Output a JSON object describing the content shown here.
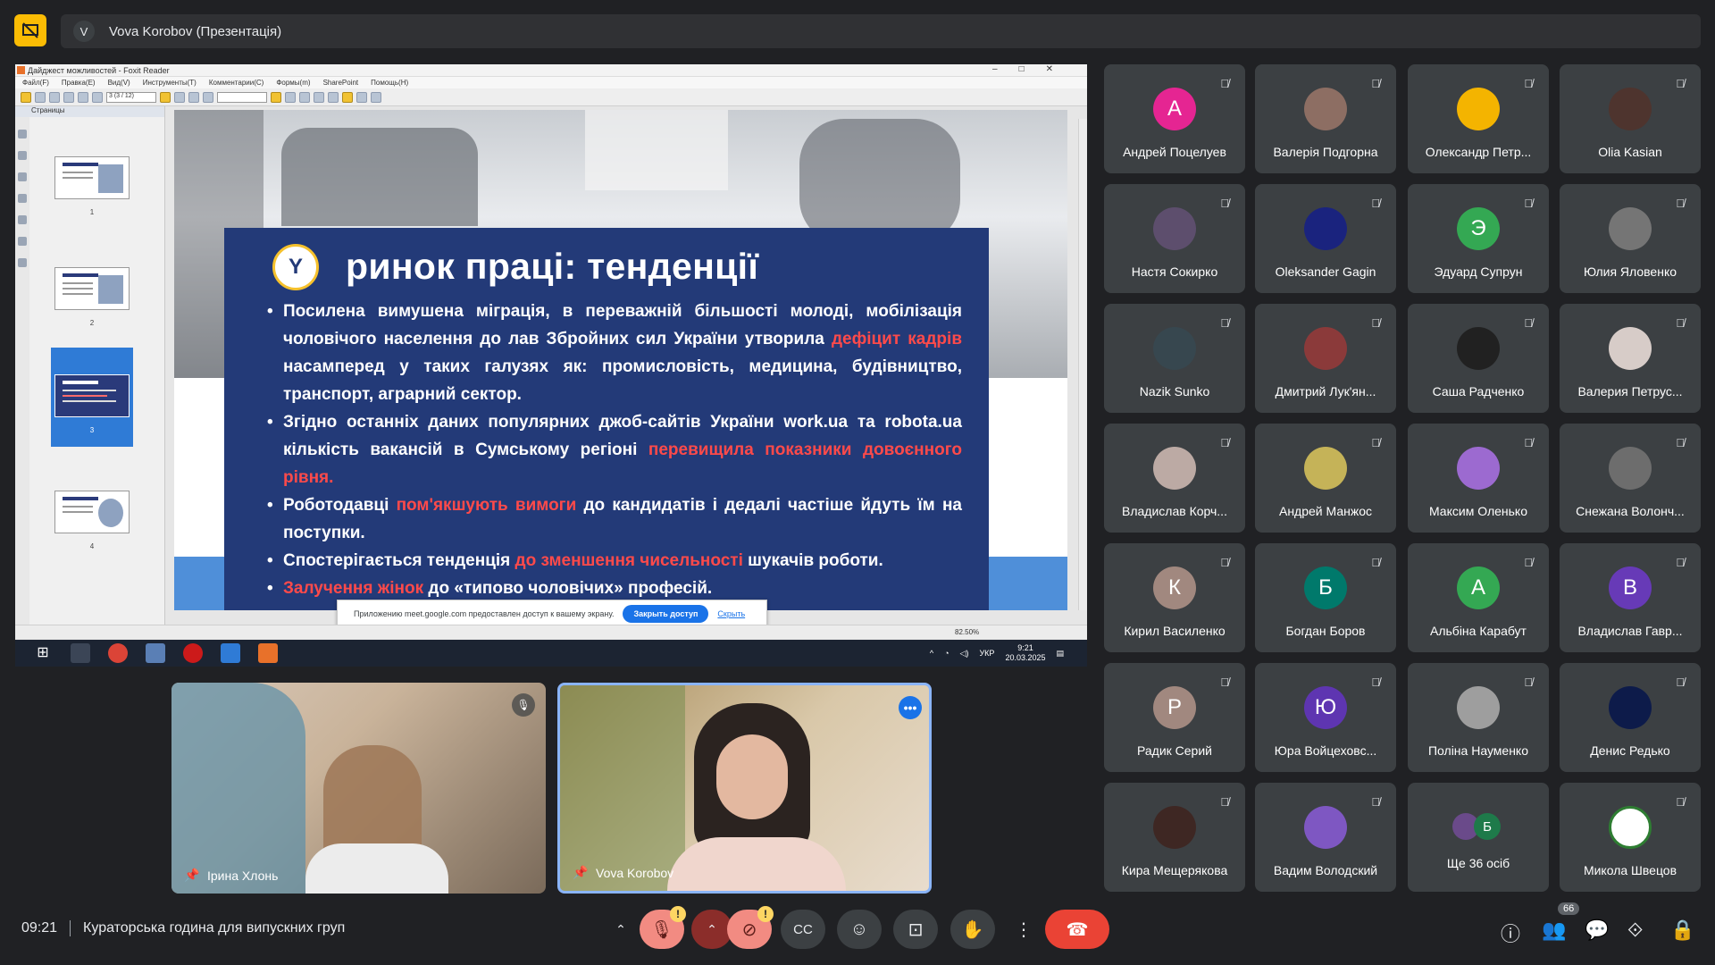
{
  "top": {
    "presenter_initial": "V",
    "presenter_label": "Vova Korobov (Презентація)"
  },
  "foxit": {
    "window_title": "Дайджест можливостей - Foxit Reader",
    "menu": [
      "Файл(F)",
      "Правка(E)",
      "Вид(V)",
      "Инструменты(T)",
      "Комментарии(C)",
      "Формы(m)",
      "SharePoint",
      "Помощь(H)"
    ],
    "page_field": "3 (3 / 12)",
    "sidebar_title": "Страницы",
    "thumbnails": [
      "1",
      "2",
      "3",
      "4"
    ],
    "zoom": "82.50%"
  },
  "slide": {
    "emblem_icon": "employment-service-emblem",
    "title": "ринок праці: тенденції",
    "b1_a": "Посилена вимушена міграція, в переважній більшості молоді, мобілізація чоловічого населення до лав Збройних сил України утворила ",
    "b1_red": "дефіцит кадрів",
    "b1_b": " насамперед у таких галузях як: промисловість, медицина, будівництво, транспорт, аграрний сектор.",
    "b2_a": "Згідно останніх даних популярних джоб-сайтів України work.ua та robota.ua кількість вакансій в Сумському регіоні ",
    "b2_red": "перевищила показники довоєнного рівня.",
    "b3_a": " Роботодавці ",
    "b3_red": "пом'якшують вимоги",
    "b3_b": " до кандидатів і дедалі частіше йдуть їм на поступки.",
    "b4_a": "Спостерігається тенденція ",
    "b4_red": "до зменшення чисельності",
    "b4_b": " шукачів роботи.",
    "b5_red": "Залучення жінок",
    "b5_b": " до «типово чоловічих» професій."
  },
  "share_notice": {
    "text": "Приложению meet.google.com предоставлен доступ к вашему экрану.",
    "stop_label": "Закрыть доступ",
    "hide_label": "Скрыть"
  },
  "taskbar": {
    "lang": "УКР",
    "time": "9:21",
    "date": "20.03.2025"
  },
  "pinned": [
    {
      "name": "Ірина Хлонь"
    },
    {
      "name": "Vova Korobov"
    }
  ],
  "participants": [
    {
      "name": "Андрей Поцелуев",
      "initial": "А",
      "color": "#e52592"
    },
    {
      "name": "Валерія Подгорна",
      "initial": "",
      "color": "#8d6e63"
    },
    {
      "name": "Олександр Петр...",
      "initial": "",
      "color": "#f4b400"
    },
    {
      "name": "Olia Kasian",
      "initial": "",
      "color": "#4e342e"
    },
    {
      "name": "Настя Сокирко",
      "initial": "",
      "color": "#5d4e6d"
    },
    {
      "name": "Oleksander Gagin",
      "initial": "",
      "color": "#1a237e"
    },
    {
      "name": "Эдуард Супрун",
      "initial": "Э",
      "color": "#34a853"
    },
    {
      "name": "Юлия Яловенко",
      "initial": "",
      "color": "#757575"
    },
    {
      "name": "Nazik Sunko",
      "initial": "",
      "color": "#37474f"
    },
    {
      "name": "Дмитрий Лук'ян...",
      "initial": "",
      "color": "#8b3a3a"
    },
    {
      "name": "Саша Радченко",
      "initial": "",
      "color": "#212121"
    },
    {
      "name": "Валерия Петрус...",
      "initial": "",
      "color": "#d7ccc8"
    },
    {
      "name": "Владислав Корч...",
      "initial": "",
      "color": "#bcaaa4"
    },
    {
      "name": "Андрей Манжос",
      "initial": "",
      "color": "#c5b358"
    },
    {
      "name": "Максим Оленько",
      "initial": "",
      "color": "#9c6ad0"
    },
    {
      "name": "Снежана Волонч...",
      "initial": "",
      "color": "#6d6d6d"
    },
    {
      "name": "Кирил Василенко",
      "initial": "К",
      "color": "#a1887f"
    },
    {
      "name": "Богдан Боров",
      "initial": "Б",
      "color": "#00796b"
    },
    {
      "name": "Альбіна Карабут",
      "initial": "А",
      "color": "#34a853"
    },
    {
      "name": "Владислав Гавр...",
      "initial": "В",
      "color": "#673ab7"
    },
    {
      "name": "Радик Серий",
      "initial": "Р",
      "color": "#a1887f"
    },
    {
      "name": "Юра Войцеховс...",
      "initial": "Ю",
      "color": "#5e35b1"
    },
    {
      "name": "Поліна Науменко",
      "initial": "",
      "color": "#9e9e9e"
    },
    {
      "name": "Денис Редько",
      "initial": "",
      "color": "#0d1b4a"
    },
    {
      "name": "Кира Мещерякова",
      "initial": "",
      "color": "#3e2723"
    },
    {
      "name": "Вадим Володский",
      "initial": "",
      "color": "#7e57c2"
    },
    {
      "name": "Ще 36 осіб",
      "initial": "Б",
      "color": "#1e7a4a"
    },
    {
      "name": "Микола Швецов",
      "initial": "",
      "color": "#ffffff"
    }
  ],
  "bottom": {
    "time": "09:21",
    "meeting_title": "Кураторська година для випускних груп",
    "participant_count": "66"
  }
}
